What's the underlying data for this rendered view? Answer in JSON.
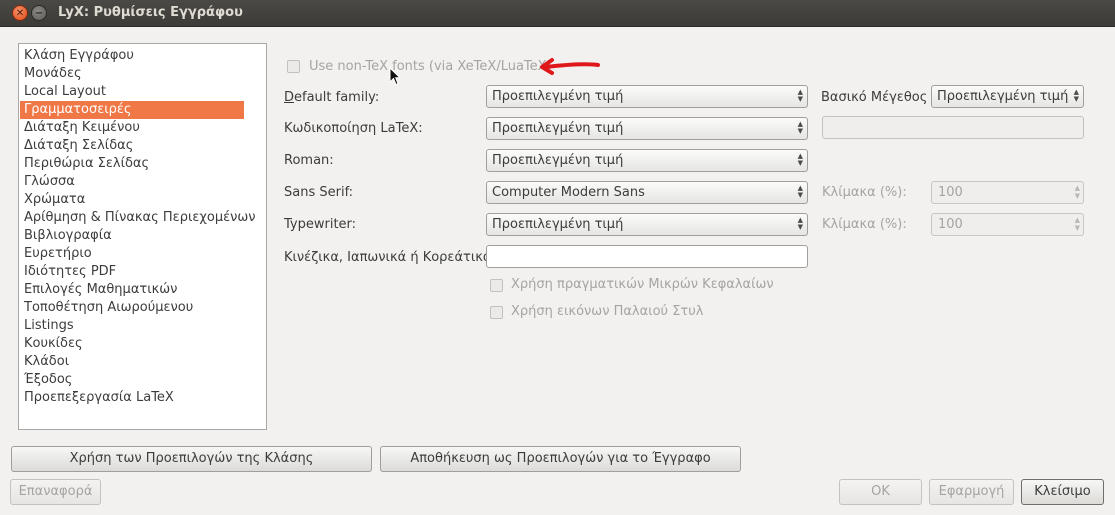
{
  "window": {
    "title": "LyX: Ρυθμίσεις Εγγράφου"
  },
  "sidebar": {
    "items": [
      "Κλάση Εγγράφου",
      "Μονάδες",
      "Local Layout",
      "Γραμματοσειρές",
      "Διάταξη Κειμένου",
      "Διάταξη Σελίδας",
      "Περιθώρια Σελίδας",
      "Γλώσσα",
      "Χρώματα",
      "Αρίθμηση & Πίνακας Περιεχομένων",
      "Βιβλιογραφία",
      "Ευρετήριο",
      "Ιδιότητες PDF",
      "Επιλογές Μαθηματικών",
      "Τοποθέτηση Αιωρούμενου",
      "Listings",
      "Κουκίδες",
      "Κλάδοι",
      "Έξοδος",
      "Προεπεξεργασία LaTeX"
    ],
    "selected_index": 3
  },
  "fonts": {
    "use_nontex": "Use non-TeX fonts (via XeTeX/LuaTeX)",
    "default_family_label": "Default family:",
    "default_family_value": "Προεπιλεγμένη τιμή",
    "latex_encoding_label": "Κωδικοποίηση LaTeX:",
    "latex_encoding_value": "Προεπιλεγμένη τιμή",
    "roman_label": "Roman:",
    "roman_value": "Προεπιλεγμένη τιμή",
    "sans_label": "Sans Serif:",
    "sans_value": "Computer Modern Sans",
    "typewriter_label": "Typewriter:",
    "typewriter_value": "Προεπιλεγμένη τιμή",
    "cjk_label": "Κινέζικα, Ιαπωνικά ή Κορεάτικα:",
    "cjk_value": "",
    "smallcaps": "Χρήση πραγματικών Μικρών Κεφαλαίων",
    "oldstyle": "Χρήση εικόνων Παλαιού Στυλ",
    "base_size_label": "Βασικό Μέγεθος",
    "base_size_value": "Προεπιλεγμένη τιμή",
    "scale_label": "Κλίμακα (%):",
    "sans_scale": "100",
    "tt_scale": "100"
  },
  "buttons": {
    "use_class_defaults": "Χρήση των Προεπιλογών της Κλάσης",
    "save_as_defaults": "Αποθήκευση ως Προεπιλογών για το Έγγραφο",
    "restore": "Επαναφορά",
    "ok": "OK",
    "apply": "Εφαρμογή",
    "close": "Κλείσιμο"
  },
  "colors": {
    "selection": "#f07746",
    "annotation_arrow": "#e0181c"
  }
}
